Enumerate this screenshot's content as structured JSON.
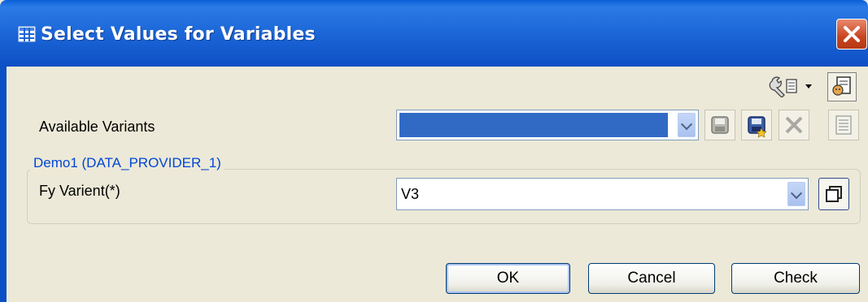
{
  "window": {
    "title": "Select Values for Variables",
    "title_icon": "grid-table-icon",
    "close_icon": "close-icon"
  },
  "toolbar": {
    "settings_icon": "wrench-settings-icon",
    "dropdown_icon": "caret-down-icon",
    "personalize_icon": "personalize-icon"
  },
  "variants": {
    "label": "Available Variants",
    "selected": "",
    "buttons": [
      "save-variant-icon",
      "save-as-variant-icon",
      "delete-variant-icon",
      "variant-details-icon"
    ]
  },
  "group": {
    "title": "Demo1 (DATA_PROVIDER_1)",
    "fields": [
      {
        "label": "Fy Varient(*)",
        "value": "V3"
      }
    ]
  },
  "buttons": {
    "ok": "OK",
    "cancel": "Cancel",
    "check": "Check"
  },
  "colors": {
    "titlebar": "#1a64d6",
    "close": "#c8441f",
    "client": "#ece9d8",
    "selection": "#316ac5",
    "group_title": "#0046d5"
  }
}
